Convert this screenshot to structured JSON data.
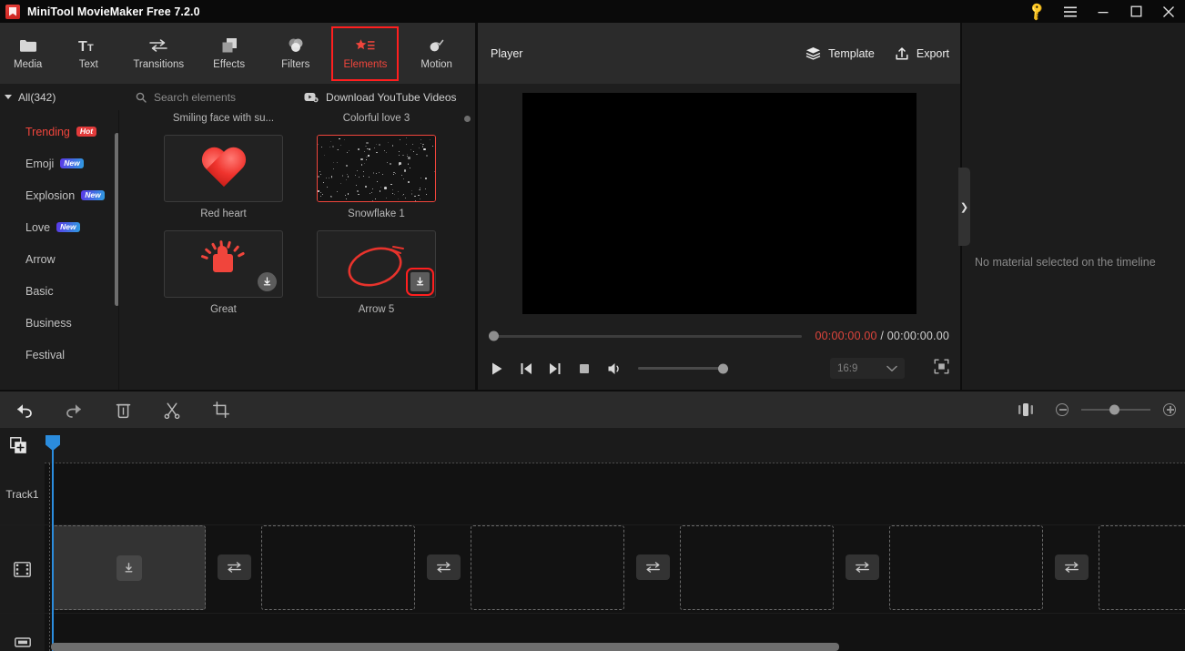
{
  "titlebar": {
    "app_name": "MiniTool MovieMaker Free 7.2.0",
    "logo_name": "minitool-logo",
    "buttons": [
      {
        "name": "activate-key-button",
        "icon": "key-icon"
      },
      {
        "name": "main-menu-button",
        "icon": "hamburger-menu-icon"
      },
      {
        "name": "minimize-button",
        "icon": "minimize-icon"
      },
      {
        "name": "maximize-button",
        "icon": "maximize-icon"
      },
      {
        "name": "close-button",
        "icon": "close-icon"
      }
    ]
  },
  "ribbon": {
    "items": [
      {
        "label": "Media",
        "icon": "folder-icon",
        "active": false
      },
      {
        "label": "Text",
        "icon": "text-icon",
        "active": false
      },
      {
        "label": "Transitions",
        "icon": "transitions-icon",
        "active": false
      },
      {
        "label": "Effects",
        "icon": "effects-icon",
        "active": false
      },
      {
        "label": "Filters",
        "icon": "filters-icon",
        "active": false
      },
      {
        "label": "Elements",
        "icon": "elements-icon",
        "active": true
      },
      {
        "label": "Motion",
        "icon": "motion-icon",
        "active": false
      }
    ],
    "highlight_color": "#ff1f1f",
    "active_color": "#f0453c"
  },
  "library_bar": {
    "all_label": "All(342)",
    "search_placeholder": "Search elements",
    "download_youtube_label": "Download YouTube Videos"
  },
  "categories": [
    {
      "label": "Trending",
      "badge": "Hot",
      "badge_type": "hot",
      "selected": true
    },
    {
      "label": "Emoji",
      "badge": "New",
      "badge_type": "new",
      "selected": false
    },
    {
      "label": "Explosion",
      "badge": "New",
      "badge_type": "new",
      "selected": false
    },
    {
      "label": "Love",
      "badge": "New",
      "badge_type": "new",
      "selected": false
    },
    {
      "label": "Arrow",
      "badge": "",
      "badge_type": "",
      "selected": false
    },
    {
      "label": "Basic",
      "badge": "",
      "badge_type": "",
      "selected": false
    },
    {
      "label": "Business",
      "badge": "",
      "badge_type": "",
      "selected": false
    },
    {
      "label": "Festival",
      "badge": "",
      "badge_type": "",
      "selected": false
    }
  ],
  "elements": [
    {
      "name": "Smiling face with su...",
      "kind": "partial",
      "selected": false,
      "downloadable": false,
      "highlight_download": false
    },
    {
      "name": "Colorful love 3",
      "kind": "partial",
      "selected": false,
      "downloadable": false,
      "highlight_download": false
    },
    {
      "name": "Red heart",
      "kind": "heart",
      "selected": false,
      "downloadable": false,
      "highlight_download": false
    },
    {
      "name": "Snowflake 1",
      "kind": "snow",
      "selected": true,
      "downloadable": false,
      "highlight_download": false
    },
    {
      "name": "Great",
      "kind": "great",
      "selected": false,
      "downloadable": true,
      "highlight_download": false
    },
    {
      "name": "Arrow 5",
      "kind": "arrow",
      "selected": false,
      "downloadable": true,
      "highlight_download": true
    }
  ],
  "player": {
    "title": "Player",
    "template_label": "Template",
    "export_label": "Export",
    "current_time": "00:00:00.00",
    "time_separator": "/",
    "total_time": "00:00:00.00",
    "current_time_color": "#e0453c",
    "aspect_ratio": "16:9",
    "controls": [
      {
        "name": "play-button",
        "icon": "play-icon"
      },
      {
        "name": "previous-frame-button",
        "icon": "skip-previous-icon"
      },
      {
        "name": "next-frame-button",
        "icon": "skip-next-icon"
      },
      {
        "name": "stop-button",
        "icon": "stop-icon"
      },
      {
        "name": "volume-button",
        "icon": "volume-icon"
      }
    ]
  },
  "right_panel": {
    "empty_message": "No material selected on the timeline",
    "collapse_icon": "❯"
  },
  "timeline_toolbar": {
    "buttons": [
      {
        "name": "undo-button",
        "icon": "undo-icon"
      },
      {
        "name": "redo-button",
        "icon": "redo-icon"
      },
      {
        "name": "delete-button",
        "icon": "trash-icon"
      },
      {
        "name": "split-button",
        "icon": "scissors-icon"
      },
      {
        "name": "crop-button",
        "icon": "crop-icon"
      }
    ],
    "right_buttons": [
      {
        "name": "fit-timeline-button",
        "icon": "fit-icon"
      },
      {
        "name": "zoom-out-button",
        "icon": "minus-circle-icon"
      },
      {
        "name": "zoom-in-button",
        "icon": "plus-circle-icon"
      }
    ]
  },
  "timeline": {
    "add_track_icon": "add-track-icon",
    "track_label": "Track1",
    "video_track_icon": "film-icon",
    "audio_track_icon": "audio-icon",
    "clip_placeholder_count": 6,
    "transition_count": 5,
    "playhead_color": "#2b8cdd"
  }
}
